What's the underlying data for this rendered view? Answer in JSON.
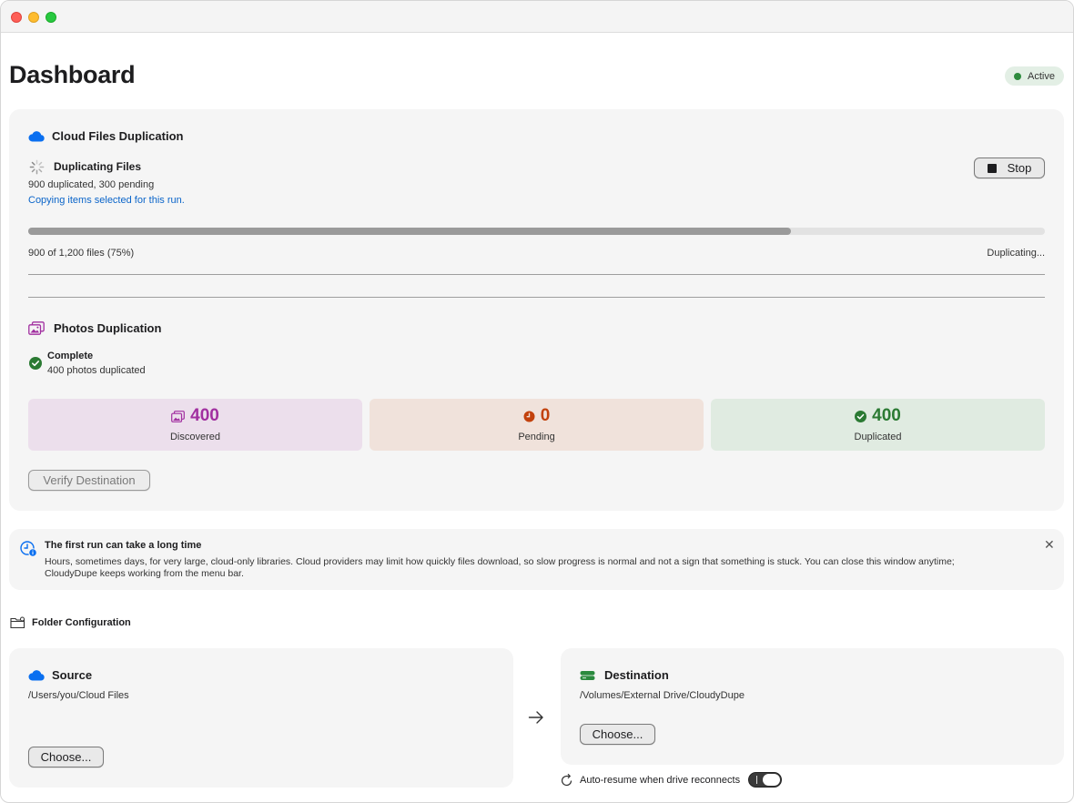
{
  "header": {
    "title": "Dashboard",
    "status": "Active",
    "status_color": "#2e8b3e"
  },
  "cloud": {
    "title": "Cloud Files Duplication",
    "state_label": "Duplicating Files",
    "counts_text": "900 duplicated, 300 pending",
    "detail_text": "Copying items selected for this run.",
    "stop_label": "Stop",
    "progress_fraction": 0.75,
    "progress_text": "900 of 1,200 files (75%)",
    "progress_status": "Duplicating..."
  },
  "photos": {
    "title": "Photos Duplication",
    "state_label": "Complete",
    "detail_text": "400 photos duplicated",
    "stats": [
      {
        "value": "400",
        "label": "Discovered",
        "color": "#a12fa0",
        "bg": "#ecdfec",
        "icon": "photo-icon"
      },
      {
        "value": "0",
        "label": "Pending",
        "color": "#c2410c",
        "bg": "#f0e2db",
        "icon": "clock-icon"
      },
      {
        "value": "400",
        "label": "Duplicated",
        "color": "#2b7a33",
        "bg": "#e0ebe1",
        "icon": "checkmark-icon"
      }
    ],
    "verify_label": "Verify Destination"
  },
  "notice": {
    "title": "The first run can take a long time",
    "line1": "Hours, sometimes days, for very large, cloud-only libraries. Cloud providers may limit how quickly files download, so slow progress is normal and not a sign that something is stuck. You can close this window anytime;",
    "line2": "CloudyDupe keeps working from the menu bar."
  },
  "folders": {
    "section_title": "Folder Configuration",
    "source": {
      "title": "Source",
      "path": "/Users/you/Cloud Files",
      "choose_label": "Choose..."
    },
    "destination": {
      "title": "Destination",
      "path": "/Volumes/External Drive/CloudyDupe",
      "choose_label": "Choose..."
    },
    "auto_resume_label": "Auto-resume when drive reconnects",
    "auto_resume_on": true
  },
  "colors": {
    "accent_blue": "#0a6ff0",
    "link_blue": "#0a64c9",
    "photos_purple": "#a12fa0",
    "drive_green": "#2b8a3e"
  }
}
